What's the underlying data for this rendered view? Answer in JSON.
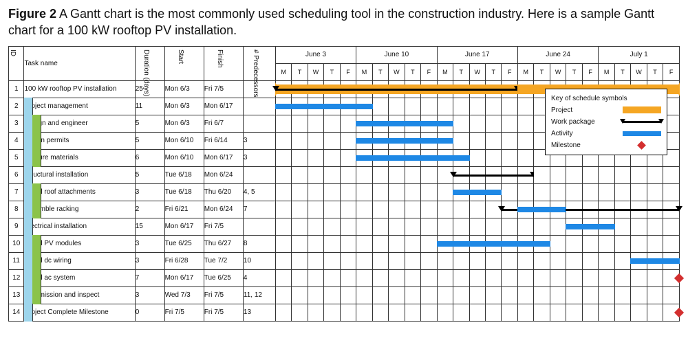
{
  "caption": {
    "label": "Figure 2",
    "text": "A Gantt chart is the most commonly used scheduling tool in the construction industry. Here is a sample Gantt chart for a 100 kW rooftop PV installation."
  },
  "columns": {
    "id": "ID",
    "task": "Task name",
    "duration": "Duration (days)",
    "start": "Start",
    "finish": "Finish",
    "pred": "# Predecessors"
  },
  "weeks": [
    "June 3",
    "June 10",
    "June 17",
    "June 24",
    "July 1"
  ],
  "days": [
    "M",
    "T",
    "W",
    "T",
    "F"
  ],
  "legend": {
    "title": "Key of schedule symbols",
    "project": "Project",
    "work_package": "Work package",
    "activity": "Activity",
    "milestone": "Milestone"
  },
  "chart_data": {
    "type": "gantt",
    "title": "100 kW rooftop PV installation — Gantt chart",
    "calendar": {
      "weeks": [
        "June 3",
        "June 10",
        "June 17",
        "June 24",
        "July 1"
      ],
      "workdays": [
        "M",
        "T",
        "W",
        "T",
        "F"
      ],
      "day_index_range": [
        0,
        24
      ]
    },
    "tasks": [
      {
        "id": 1,
        "name": "100 kW rooftop PV installation",
        "level": 0,
        "type": "project",
        "duration_days": 25,
        "start": "Mon 6/3",
        "finish": "Fri 7/5",
        "predecessors": "",
        "bar": [
          0,
          24
        ],
        "wp_bar": [
          0,
          14
        ]
      },
      {
        "id": 2,
        "name": "Project management",
        "level": 1,
        "type": "work_package",
        "duration_days": 11,
        "start": "Mon 6/3",
        "finish": "Mon 6/17",
        "predecessors": "",
        "act_bar": [
          0,
          5
        ],
        "wp_bar": null
      },
      {
        "id": 3,
        "name": "Design and engineer",
        "level": 2,
        "type": "activity",
        "duration_days": 5,
        "start": "Mon 6/3",
        "finish": "Fri 6/7",
        "predecessors": "",
        "act_bar": [
          5,
          10
        ]
      },
      {
        "id": 4,
        "name": "Obtain permits",
        "level": 2,
        "type": "activity",
        "duration_days": 5,
        "start": "Mon 6/10",
        "finish": "Fri 6/14",
        "predecessors": "3",
        "act_bar": [
          5,
          10
        ]
      },
      {
        "id": 5,
        "name": "Procure materials",
        "level": 2,
        "type": "activity",
        "duration_days": 6,
        "start": "Mon 6/10",
        "finish": "Mon 6/17",
        "predecessors": "3",
        "act_bar": [
          5,
          11
        ]
      },
      {
        "id": 6,
        "name": "Structural installation",
        "level": 1,
        "type": "work_package",
        "duration_days": 5,
        "start": "Tue 6/18",
        "finish": "Mon 6/24",
        "predecessors": "",
        "wp_bar": [
          11,
          15
        ]
      },
      {
        "id": 7,
        "name": "Install roof attachments",
        "level": 2,
        "type": "activity",
        "duration_days": 3,
        "start": "Tue 6/18",
        "finish": "Thu 6/20",
        "predecessors": "4, 5",
        "act_bar": [
          11,
          13
        ]
      },
      {
        "id": 8,
        "name": "Assemble racking",
        "level": 2,
        "type": "activity",
        "duration_days": 2,
        "start": "Fri 6/21",
        "finish": "Mon 6/24",
        "predecessors": "7",
        "wp_bar": [
          14,
          24
        ],
        "act_bar": [
          15,
          17
        ]
      },
      {
        "id": 9,
        "name": "Electrical installation",
        "level": 1,
        "type": "work_package",
        "duration_days": 15,
        "start": "Mon 6/17",
        "finish": "Fri 7/5",
        "predecessors": "",
        "act_bar": [
          18,
          20
        ]
      },
      {
        "id": 10,
        "name": "Install PV modules",
        "level": 2,
        "type": "activity",
        "duration_days": 3,
        "start": "Tue 6/25",
        "finish": "Thu 6/27",
        "predecessors": "8",
        "act_bar": [
          10,
          16
        ]
      },
      {
        "id": 11,
        "name": "Install dc wiring",
        "level": 2,
        "type": "activity",
        "duration_days": 3,
        "start": "Fri 6/28",
        "finish": "Tue 7/2",
        "predecessors": "10",
        "act_bar": [
          22,
          24
        ]
      },
      {
        "id": 12,
        "name": "Install ac system",
        "level": 2,
        "type": "activity",
        "duration_days": 7,
        "start": "Mon 6/17",
        "finish": "Tue 6/25",
        "predecessors": "4",
        "milestone_at": 24
      },
      {
        "id": 13,
        "name": "Commission and inspect",
        "level": 2,
        "type": "activity",
        "duration_days": 3,
        "start": "Wed 7/3",
        "finish": "Fri 7/5",
        "predecessors": "11, 12",
        "act_bar": null
      },
      {
        "id": 14,
        "name": "Project Complete Milestone",
        "level": 1,
        "type": "milestone",
        "duration_days": 0,
        "start": "Fri 7/5",
        "finish": "Fri 7/5",
        "predecessors": "13",
        "milestone_at": 24
      }
    ]
  }
}
